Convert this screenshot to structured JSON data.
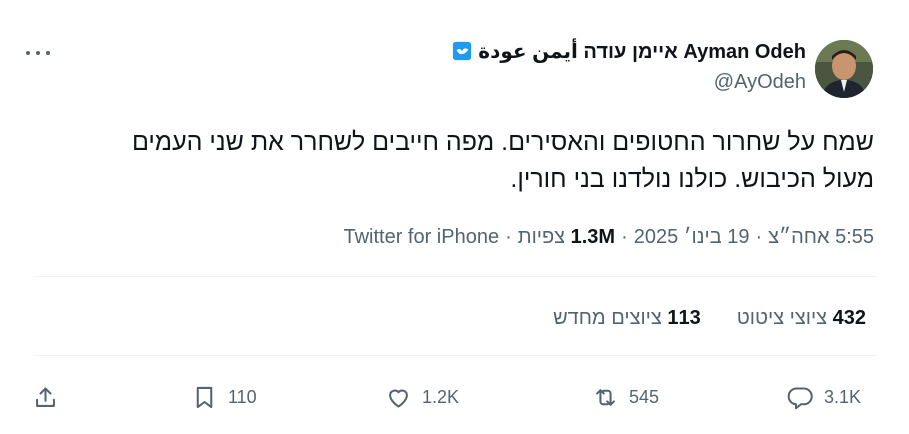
{
  "tweet": {
    "author": {
      "display_name": "Ayman Odeh איימן עודה أيمن عودة",
      "handle": "@AyOdeh"
    },
    "text_line1": "שמח על שחרור החטופים והאסירים. מפה חייבים לשחרר את שני העמים",
    "text_line2": "מעול הכיבוש. כולנו נולדנו בני חורין.",
    "time": "5:55 אחה״צ",
    "date": "19 בינו׳ 2025",
    "views_count": "1.3M",
    "views_label": "צפיות",
    "source": "Twitter for iPhone",
    "separator": "·"
  },
  "stats": {
    "quotes_count": "432",
    "quotes_label": "ציוצי ציטוט",
    "retweets_count": "113",
    "retweets_label": "ציוצים מחדש"
  },
  "actions": {
    "replies": "3.1K",
    "retweets": "545",
    "likes": "1.2K",
    "bookmarks": "110"
  },
  "icons": {
    "verified": "verified-badge-icon",
    "more": "more-icon",
    "reply": "reply-icon",
    "retweet": "retweet-icon",
    "like": "heart-icon",
    "bookmark": "bookmark-icon",
    "share": "share-icon"
  },
  "colors": {
    "text": "#0f1419",
    "secondary": "#536471",
    "verified": "#1d9bf0",
    "divider": "#eff3f4"
  }
}
